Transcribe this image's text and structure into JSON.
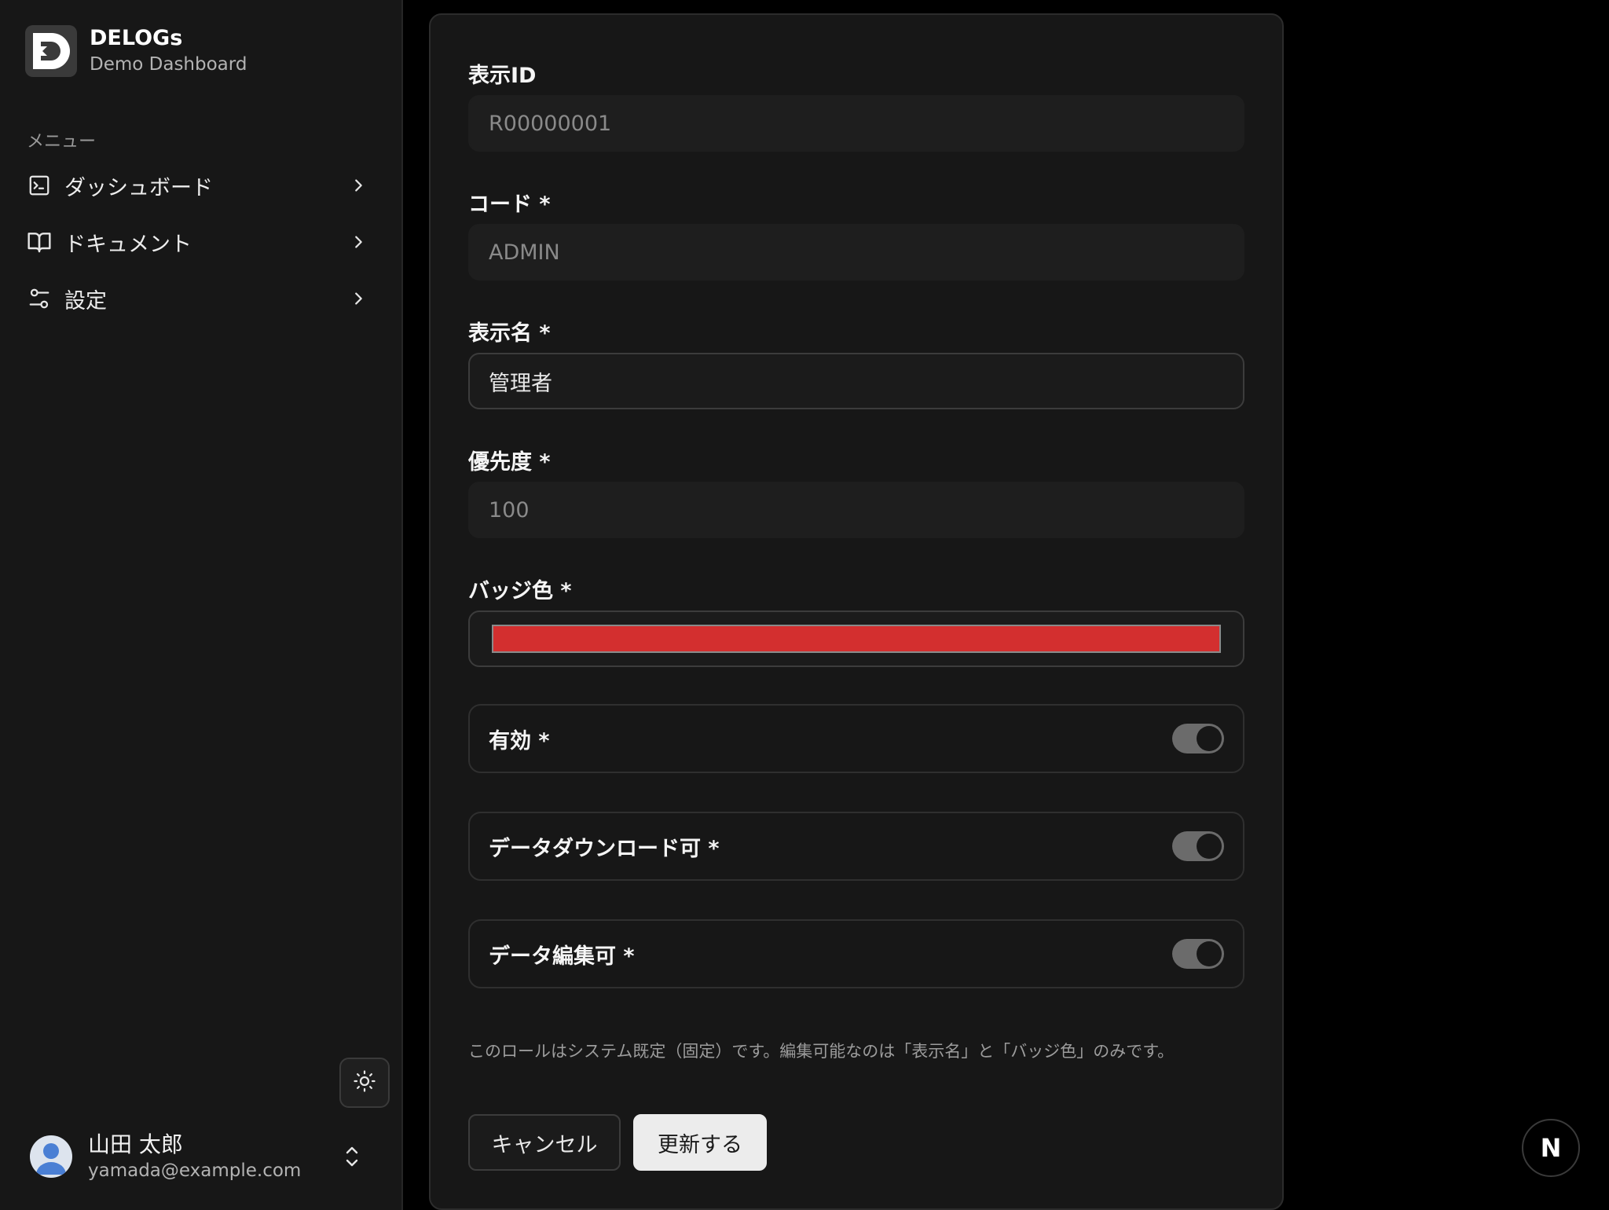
{
  "brand": {
    "name": "DELOGs",
    "subtitle": "Demo Dashboard"
  },
  "sidebar": {
    "menu_label": "メニュー",
    "items": [
      {
        "label": "ダッシュボード",
        "icon": "terminal-square-icon"
      },
      {
        "label": "ドキュメント",
        "icon": "book-open-icon"
      },
      {
        "label": "設定",
        "icon": "settings-sliders-icon"
      }
    ]
  },
  "user": {
    "name": "山田 太郎",
    "email": "yamada@example.com"
  },
  "form": {
    "display_id": {
      "label": "表示ID",
      "value": "R00000001"
    },
    "code": {
      "label": "コード *",
      "value": "ADMIN"
    },
    "display_name": {
      "label": "表示名 *",
      "value": "管理者"
    },
    "priority": {
      "label": "優先度 *",
      "value": "100"
    },
    "badge_color": {
      "label": "バッジ色 *",
      "value": "#d32f2f"
    },
    "toggles": [
      {
        "label": "有効 *",
        "on": true
      },
      {
        "label": "データダウンロード可 *",
        "on": true
      },
      {
        "label": "データ編集可 *",
        "on": true
      }
    ],
    "note": "このロールはシステム既定（固定）です。編集可能なのは「表示名」と「バッジ色」のみです。",
    "cancel_label": "キャンセル",
    "submit_label": "更新する"
  },
  "corner_badge": {
    "label": "N"
  }
}
